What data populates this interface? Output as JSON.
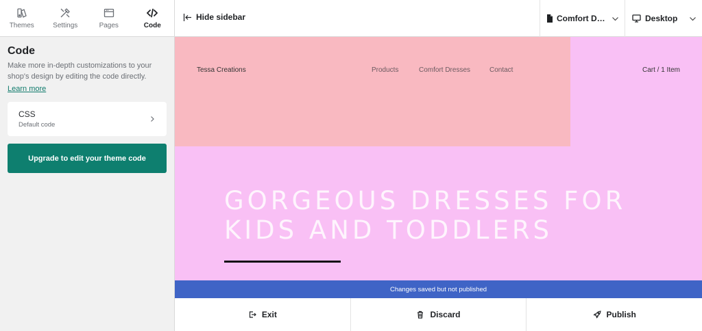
{
  "sidebar": {
    "tabs": [
      {
        "label": "Themes",
        "icon": "themes-icon"
      },
      {
        "label": "Settings",
        "icon": "settings-icon"
      },
      {
        "label": "Pages",
        "icon": "pages-icon"
      },
      {
        "label": "Code",
        "icon": "code-icon",
        "active": true
      }
    ],
    "title": "Code",
    "description": "Make more in-depth customizations to your shop's design by editing the code directly.",
    "learn_more": "Learn more",
    "css_card": {
      "title": "CSS",
      "subtitle": "Default code"
    },
    "upgrade_button": "Upgrade to edit your theme code"
  },
  "topbar": {
    "hide_sidebar": "Hide sidebar",
    "page_select": "Comfort Dresses",
    "device_select": "Desktop"
  },
  "preview": {
    "brand": "Tessa Creations",
    "nav": [
      "Products",
      "Comfort Dresses",
      "Contact"
    ],
    "cart": "Cart / 1 Item",
    "hero_line1": "GORGEOUS DRESSES FOR",
    "hero_line2": "KIDS AND TODDLERS"
  },
  "status": "Changes saved but not published",
  "actions": {
    "exit": "Exit",
    "discard": "Discard",
    "publish": "Publish"
  },
  "colors": {
    "accent": "#0e7f6f",
    "status_bar": "#3f64c6",
    "header_block": "#f9b9c1",
    "page_bg": "#f9c0f5"
  }
}
